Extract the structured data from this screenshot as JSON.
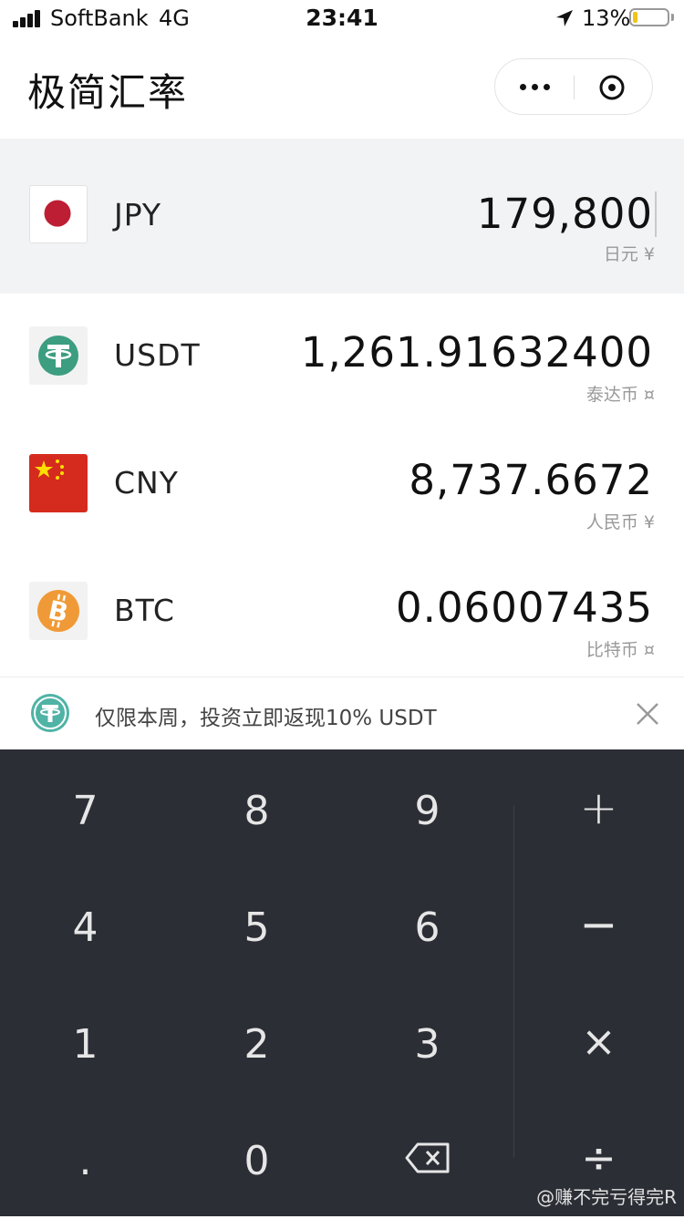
{
  "status_bar": {
    "carrier": "SoftBank",
    "network": "4G",
    "time": "23:41",
    "battery_percent": "13%",
    "battery_level": 0.13
  },
  "header": {
    "title": "极简汇率"
  },
  "currencies": [
    {
      "code": "JPY",
      "amount": "179,800",
      "name": "日元 ¥",
      "flag_icon": "japan-flag-icon",
      "active": true
    },
    {
      "code": "USDT",
      "amount": "1,261.91632400",
      "name": "泰达币 ¤",
      "flag_icon": "tether-icon",
      "active": false
    },
    {
      "code": "CNY",
      "amount": "8,737.6672",
      "name": "人民币 ¥",
      "flag_icon": "china-flag-icon",
      "active": false
    },
    {
      "code": "BTC",
      "amount": "0.06007435",
      "name": "比特币 ¤",
      "flag_icon": "bitcoin-icon",
      "active": false
    }
  ],
  "promo": {
    "text": "仅限本周，投资立即返现10% USDT",
    "icon": "tether-coin-icon"
  },
  "keypad": {
    "k7": "7",
    "k8": "8",
    "k9": "9",
    "k4": "4",
    "k5": "5",
    "k6": "6",
    "k1": "1",
    "k2": "2",
    "k3": "3",
    "kdot": ".",
    "k0": "0",
    "plus": "+",
    "minus": "−",
    "times": "×",
    "divide": "÷"
  },
  "watermark": "@赚不完亏得完R",
  "colors": {
    "keypad_bg": "#2b2e35",
    "active_row_bg": "#f2f3f5",
    "tether_green": "#3c9d80",
    "bitcoin_orange": "#f09a37",
    "china_red": "#d52b1e",
    "japan_red": "#bd1e34"
  }
}
